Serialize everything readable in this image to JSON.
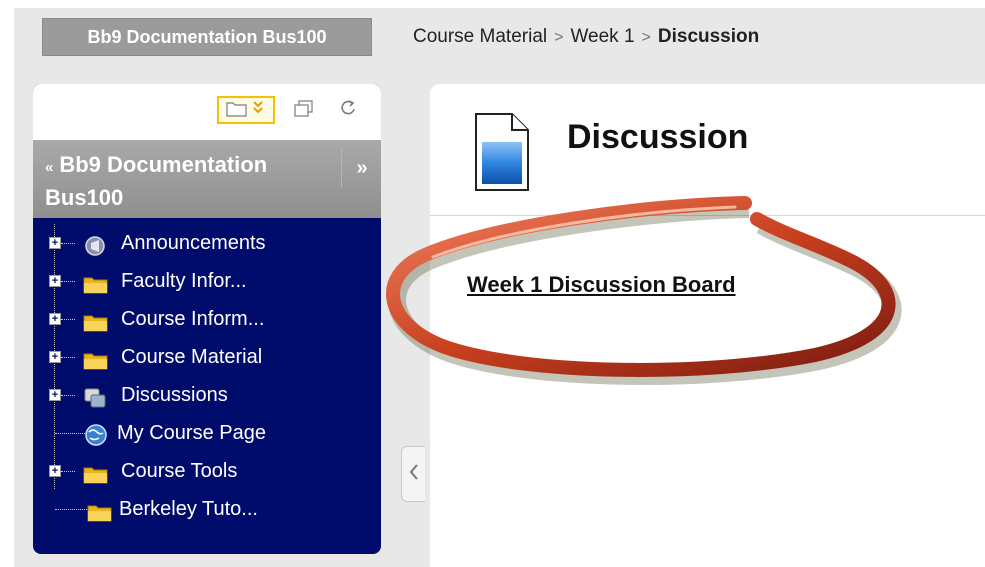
{
  "breadcrumb": {
    "course_label": "Bb9 Documentation Bus100",
    "items": [
      "Course Material",
      "Week 1"
    ],
    "current": "Discussion",
    "separator": ">"
  },
  "menu": {
    "title": "Bb9 Documentation Bus100",
    "expand_symbol": "»",
    "collapse_symbol": "«",
    "toolbar": {
      "folder_view_icon": "folder-view-icon",
      "window_icon": "window-icon",
      "refresh_icon": "refresh-icon"
    },
    "items": [
      {
        "label": "Announcements",
        "icon": "announcements-icon",
        "expandable": true
      },
      {
        "label": "Faculty Infor...",
        "icon": "folder-icon",
        "expandable": true
      },
      {
        "label": "Course Inform...",
        "icon": "folder-icon",
        "expandable": true
      },
      {
        "label": "Course Material",
        "icon": "folder-icon",
        "expandable": true
      },
      {
        "label": "Discussions",
        "icon": "discussions-icon",
        "expandable": true
      },
      {
        "label": "My Course Page",
        "icon": "globe-icon",
        "expandable": false
      },
      {
        "label": "Course Tools",
        "icon": "folder-icon",
        "expandable": true
      },
      {
        "label": "Berkeley Tuto...",
        "icon": "folder-icon",
        "expandable": false
      }
    ]
  },
  "content": {
    "title": "Discussion",
    "link_label": "Week 1 Discussion Board"
  },
  "colors": {
    "menu_background": "#000c6b",
    "header_grey": "#9b9b9b",
    "ellipse_red": "#d9532e",
    "toolbar_highlight": "#f2c200"
  }
}
